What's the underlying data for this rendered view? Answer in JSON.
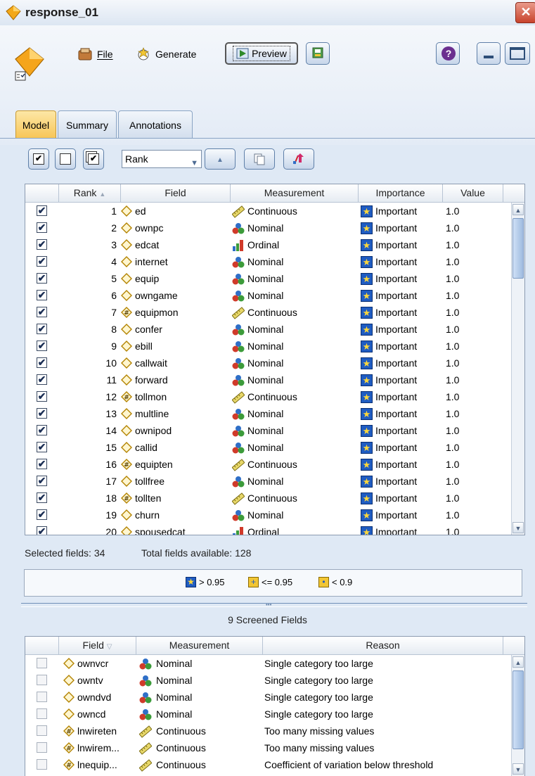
{
  "window": {
    "title": "response_01",
    "close_glyph": "✕"
  },
  "toolbar": {
    "file_label": "File",
    "generate_label": "Generate",
    "preview_label": "Preview",
    "help_glyph": "?"
  },
  "tabs": [
    {
      "label": "Model",
      "active": true
    },
    {
      "label": "Summary",
      "active": false
    },
    {
      "label": "Annotations",
      "active": false
    }
  ],
  "sort": {
    "selected": "Rank",
    "up_glyph": "▲"
  },
  "main_table": {
    "headers": {
      "rank": "Rank",
      "field": "Field",
      "measurement": "Measurement",
      "importance": "Importance",
      "value": "Value"
    },
    "rows": [
      {
        "checked": true,
        "rank": "1",
        "field": "ed",
        "field_icon": "diamond",
        "measurement": "Continuous",
        "measurement_icon": "ruler-icon",
        "importance": "Important",
        "value": "1.0"
      },
      {
        "checked": true,
        "rank": "2",
        "field": "ownpc",
        "field_icon": "diamond",
        "measurement": "Nominal",
        "measurement_icon": "nominal-icon",
        "importance": "Important",
        "value": "1.0"
      },
      {
        "checked": true,
        "rank": "3",
        "field": "edcat",
        "field_icon": "diamond",
        "measurement": "Ordinal",
        "measurement_icon": "ordinal-icon",
        "importance": "Important",
        "value": "1.0"
      },
      {
        "checked": true,
        "rank": "4",
        "field": "internet",
        "field_icon": "diamond",
        "measurement": "Nominal",
        "measurement_icon": "nominal-icon",
        "importance": "Important",
        "value": "1.0"
      },
      {
        "checked": true,
        "rank": "5",
        "field": "equip",
        "field_icon": "diamond",
        "measurement": "Nominal",
        "measurement_icon": "nominal-icon",
        "importance": "Important",
        "value": "1.0"
      },
      {
        "checked": true,
        "rank": "6",
        "field": "owngame",
        "field_icon": "diamond",
        "measurement": "Nominal",
        "measurement_icon": "nominal-icon",
        "importance": "Important",
        "value": "1.0"
      },
      {
        "checked": true,
        "rank": "7",
        "field": "equipmon",
        "field_icon": "hash",
        "measurement": "Continuous",
        "measurement_icon": "ruler-icon",
        "importance": "Important",
        "value": "1.0"
      },
      {
        "checked": true,
        "rank": "8",
        "field": "confer",
        "field_icon": "diamond",
        "measurement": "Nominal",
        "measurement_icon": "nominal-icon",
        "importance": "Important",
        "value": "1.0"
      },
      {
        "checked": true,
        "rank": "9",
        "field": "ebill",
        "field_icon": "diamond",
        "measurement": "Nominal",
        "measurement_icon": "nominal-icon",
        "importance": "Important",
        "value": "1.0"
      },
      {
        "checked": true,
        "rank": "10",
        "field": "callwait",
        "field_icon": "diamond",
        "measurement": "Nominal",
        "measurement_icon": "nominal-icon",
        "importance": "Important",
        "value": "1.0"
      },
      {
        "checked": true,
        "rank": "11",
        "field": "forward",
        "field_icon": "diamond",
        "measurement": "Nominal",
        "measurement_icon": "nominal-icon",
        "importance": "Important",
        "value": "1.0"
      },
      {
        "checked": true,
        "rank": "12",
        "field": "tollmon",
        "field_icon": "hash",
        "measurement": "Continuous",
        "measurement_icon": "ruler-icon",
        "importance": "Important",
        "value": "1.0"
      },
      {
        "checked": true,
        "rank": "13",
        "field": "multline",
        "field_icon": "diamond",
        "measurement": "Nominal",
        "measurement_icon": "nominal-icon",
        "importance": "Important",
        "value": "1.0"
      },
      {
        "checked": true,
        "rank": "14",
        "field": "ownipod",
        "field_icon": "diamond",
        "measurement": "Nominal",
        "measurement_icon": "nominal-icon",
        "importance": "Important",
        "value": "1.0"
      },
      {
        "checked": true,
        "rank": "15",
        "field": "callid",
        "field_icon": "diamond",
        "measurement": "Nominal",
        "measurement_icon": "nominal-icon",
        "importance": "Important",
        "value": "1.0"
      },
      {
        "checked": true,
        "rank": "16",
        "field": "equipten",
        "field_icon": "hash",
        "measurement": "Continuous",
        "measurement_icon": "ruler-icon",
        "importance": "Important",
        "value": "1.0"
      },
      {
        "checked": true,
        "rank": "17",
        "field": "tollfree",
        "field_icon": "diamond",
        "measurement": "Nominal",
        "measurement_icon": "nominal-icon",
        "importance": "Important",
        "value": "1.0"
      },
      {
        "checked": true,
        "rank": "18",
        "field": "tollten",
        "field_icon": "hash",
        "measurement": "Continuous",
        "measurement_icon": "ruler-icon",
        "importance": "Important",
        "value": "1.0"
      },
      {
        "checked": true,
        "rank": "19",
        "field": "churn",
        "field_icon": "diamond",
        "measurement": "Nominal",
        "measurement_icon": "nominal-icon",
        "importance": "Important",
        "value": "1.0"
      },
      {
        "checked": true,
        "rank": "20",
        "field": "spousedcat",
        "field_icon": "diamond",
        "measurement": "Ordinal",
        "measurement_icon": "ordinal-icon",
        "importance": "Important",
        "value": "1.0"
      }
    ]
  },
  "status": {
    "selected": "Selected fields: 34",
    "total": "Total fields available: 128"
  },
  "legend": [
    {
      "label": "> 0.95",
      "glyph": "★"
    },
    {
      "label": "<= 0.95",
      "glyph": "+"
    },
    {
      "label": "< 0.9",
      "glyph": "•"
    }
  ],
  "screened": {
    "title": "9 Screened Fields",
    "headers": {
      "field": "Field",
      "measurement": "Measurement",
      "reason": "Reason"
    },
    "rows": [
      {
        "checked": false,
        "field": "ownvcr",
        "field_icon": "diamond",
        "measurement": "Nominal",
        "measurement_icon": "nominal-icon",
        "reason": "Single category too large"
      },
      {
        "checked": false,
        "field": "owntv",
        "field_icon": "diamond",
        "measurement": "Nominal",
        "measurement_icon": "nominal-icon",
        "reason": "Single category too large"
      },
      {
        "checked": false,
        "field": "owndvd",
        "field_icon": "diamond",
        "measurement": "Nominal",
        "measurement_icon": "nominal-icon",
        "reason": "Single category too large"
      },
      {
        "checked": false,
        "field": "owncd",
        "field_icon": "diamond",
        "measurement": "Nominal",
        "measurement_icon": "nominal-icon",
        "reason": "Single category too large"
      },
      {
        "checked": false,
        "field": "lnwireten",
        "field_icon": "hash",
        "measurement": "Continuous",
        "measurement_icon": "ruler-icon",
        "reason": "Too many missing values"
      },
      {
        "checked": false,
        "field": "lnwirem...",
        "field_icon": "hash",
        "measurement": "Continuous",
        "measurement_icon": "ruler-icon",
        "reason": "Too many missing values"
      },
      {
        "checked": false,
        "field": "lnequip...",
        "field_icon": "hash",
        "measurement": "Continuous",
        "measurement_icon": "ruler-icon",
        "reason": "Coefficient of variation below threshold"
      }
    ]
  },
  "colors": {
    "accent_tab": "#f7c556",
    "importance_star": "#1f5cc2",
    "window_bg": "#dfe9f5"
  }
}
